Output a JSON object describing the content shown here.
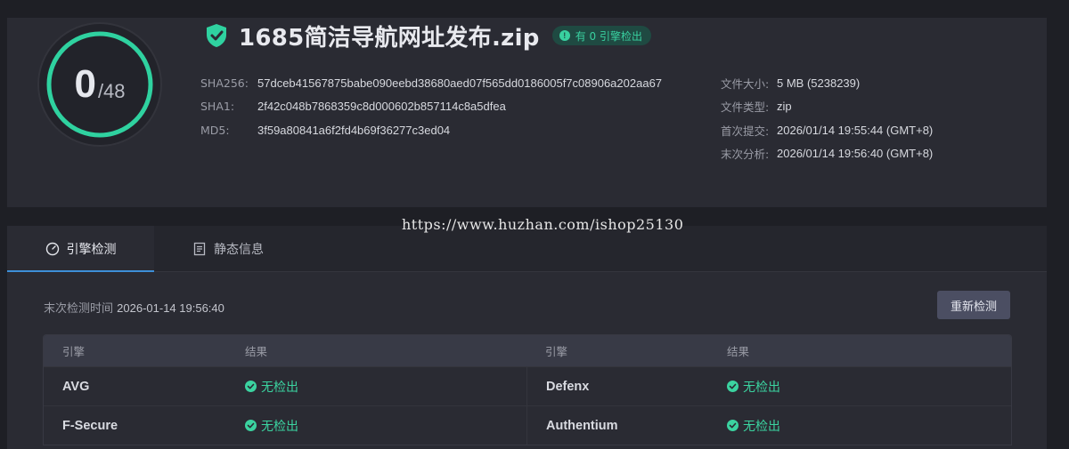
{
  "score": {
    "detected": "0",
    "total": "/48",
    "ring_color": "#2fd2a0"
  },
  "file": {
    "name": "1685简洁导航网址发布.zip",
    "badge": "有 0 引擎检出",
    "shield_color": "#2fd2a0"
  },
  "hashes": [
    {
      "label": "SHA256:",
      "value": "57dceb41567875babe090eebd38680aed07f565dd0186005f7c08906a202aa67"
    },
    {
      "label": "SHA1:",
      "value": "2f42c048b7868359c8d000602b857114c8a5dfea"
    },
    {
      "label": "MD5:",
      "value": "3f59a80841a6f2fd4b69f36277c3ed04"
    }
  ],
  "meta": [
    {
      "label": "文件大小:",
      "value": "5 MB (5238239)"
    },
    {
      "label": "文件类型:",
      "value": "zip"
    },
    {
      "label": "首次提交:",
      "value": "2026/01/14 19:55:44 (GMT+8)"
    },
    {
      "label": "末次分析:",
      "value": "2026/01/14 19:56:40 (GMT+8)"
    }
  ],
  "watermark": "https://www.huzhan.com/ishop25130",
  "tabs": [
    {
      "label": "引擎检测",
      "icon": "speedometer-icon"
    },
    {
      "label": "静态信息",
      "icon": "document-icon"
    }
  ],
  "scan": {
    "last_label": "末次检测时间",
    "last_time": "2026-01-14 19:56:40",
    "rescan_label": "重新检测"
  },
  "table": {
    "headers": [
      "引擎",
      "结果",
      "引擎",
      "结果"
    ],
    "rows": [
      {
        "engine1": "AVG",
        "result1": "无检出",
        "engine2": "Defenx",
        "result2": "无检出"
      },
      {
        "engine1": "F-Secure",
        "result1": "无检出",
        "engine2": "Authentium",
        "result2": "无检出"
      }
    ]
  }
}
